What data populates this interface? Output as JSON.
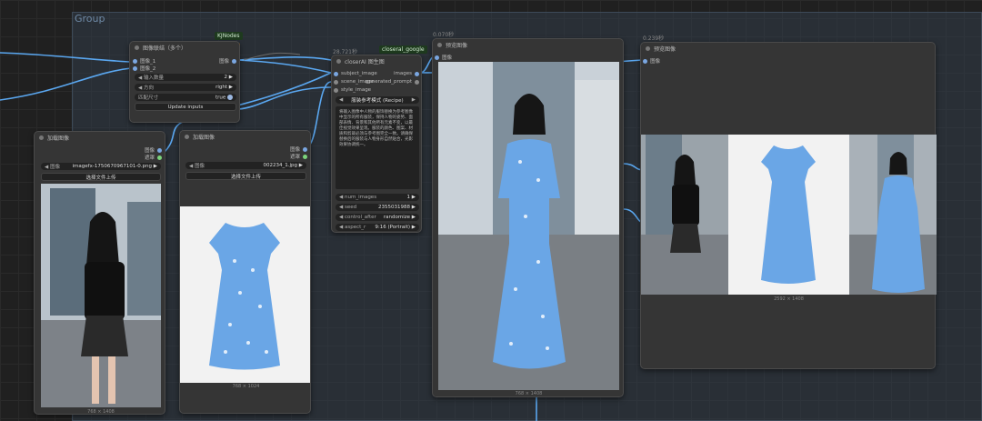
{
  "group": {
    "title": "Group"
  },
  "badges": {
    "kjnodes": "KJNodes",
    "closeral": "closeral_google",
    "warn": "?"
  },
  "timings": {
    "closer": "28.721秒",
    "preview1": "0.070秒",
    "preview2": "0.239秒"
  },
  "combine_node": {
    "title": "图像联结（多个）",
    "inputs": [
      "图像_1",
      "图像_2"
    ],
    "output": "图像",
    "widgets": [
      {
        "label": "输入数量",
        "value": "2"
      },
      {
        "label": "方向",
        "value": "right"
      },
      {
        "label": "匹配尺寸",
        "value": "true"
      }
    ],
    "button": "Update inputs"
  },
  "load1": {
    "title": "加载图像",
    "outputs": [
      "图像",
      "遮罩"
    ],
    "file_label": "图像",
    "file": "imagefx-1750670967101-0.png",
    "upload": "选择文件上传",
    "caption": "768 × 1408"
  },
  "load2": {
    "title": "加载图像",
    "outputs": [
      "图像",
      "遮罩"
    ],
    "file_label": "图像",
    "file": "002234_1.jpg",
    "upload": "选择文件上传",
    "caption": "768 × 1024"
  },
  "closer": {
    "title": "closerAI 图生图",
    "inputs": [
      "subject_image",
      "scene_image",
      "style_image"
    ],
    "outputs": [
      "images",
      "generated_prompt"
    ],
    "mode_value": "服装参考模式 (Recipe)",
    "prompt": "将输入图像中人物的服饰替换为参考图像中显示的所有服装，保持人物的姿势、面部表情、背景和其他所有元素不变，以最佳视觉效果呈现。服装的颜色、图案、材质和剪裁必须与参考图完全一致。请确保替换后的服装与人物身形自然贴合，光影效果协调统一。",
    "widgets": [
      {
        "label": "num_images",
        "value": "1"
      },
      {
        "label": "seed",
        "value": "2355031988"
      },
      {
        "label": "control_after",
        "value": "randomize"
      },
      {
        "label": "aspect_r",
        "value": "9:16 (Portrait)"
      }
    ]
  },
  "preview1": {
    "title": "预览图像",
    "input": "图像",
    "caption": "768 × 1408"
  },
  "preview2": {
    "title": "预览图像",
    "input": "图像",
    "caption": "2592 × 1408"
  },
  "colors": {
    "accent_wire": "#5aa7f0",
    "dress_blue": "#6aa6e6",
    "node_bg": "#353535"
  }
}
